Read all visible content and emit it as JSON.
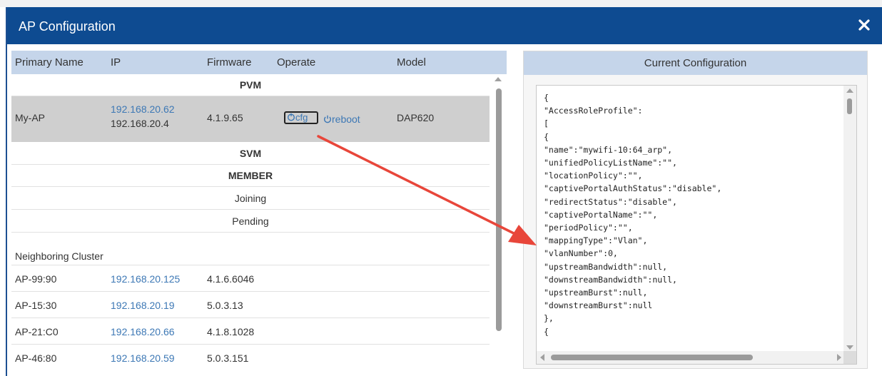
{
  "dialog": {
    "title": "AP Configuration",
    "close_icon": "close-icon"
  },
  "ap_table": {
    "columns": [
      "Primary Name",
      "IP",
      "Firmware",
      "Operate",
      "Model"
    ],
    "sections": {
      "pvm": "PVM",
      "svm": "SVM",
      "member": "MEMBER",
      "joining": "Joining",
      "pending": "Pending",
      "neighboring": "Neighboring Cluster"
    },
    "pvm_row": {
      "name": "My-AP",
      "ip_primary": "192.168.20.62",
      "ip_secondary": "192.168.20.4",
      "firmware": "4.1.9.65",
      "cfg_label": "cfg",
      "reboot_label": "reboot",
      "model": "DAP620"
    },
    "neighbors": [
      {
        "name": "AP-99:90",
        "ip": "192.168.20.125",
        "firmware": "4.1.6.6046"
      },
      {
        "name": "AP-15:30",
        "ip": "192.168.20.19",
        "firmware": "5.0.3.13"
      },
      {
        "name": "AP-21:C0",
        "ip": "192.168.20.66",
        "firmware": "4.1.8.1028"
      },
      {
        "name": "AP-46:80",
        "ip": "192.168.20.59",
        "firmware": "5.0.3.151"
      }
    ]
  },
  "config_panel": {
    "header": "Current Configuration",
    "lines": [
      "{",
      "\"AccessRoleProfile\":",
      "[",
      "{",
      "\"name\":\"mywifi-10:64_arp\",",
      "\"unifiedPolicyListName\":\"\",",
      "\"locationPolicy\":\"\",",
      "\"captivePortalAuthStatus\":\"disable\",",
      "\"redirectStatus\":\"disable\",",
      "\"captivePortalName\":\"\",",
      "\"periodPolicy\":\"\",",
      "\"mappingType\":\"Vlan\",",
      "\"vlanNumber\":0,",
      "\"upstreamBandwidth\":null,",
      "\"downstreamBandwidth\":null,",
      "\"upstreamBurst\":null,",
      "\"downstreamBurst\":null",
      "},",
      "{"
    ]
  },
  "colors": {
    "titlebar": "#0e4b91",
    "header_bg": "#c5d5ea",
    "link": "#3d78b5",
    "selected_row": "#cfcfcf",
    "annotation_arrow": "#e8463a"
  }
}
